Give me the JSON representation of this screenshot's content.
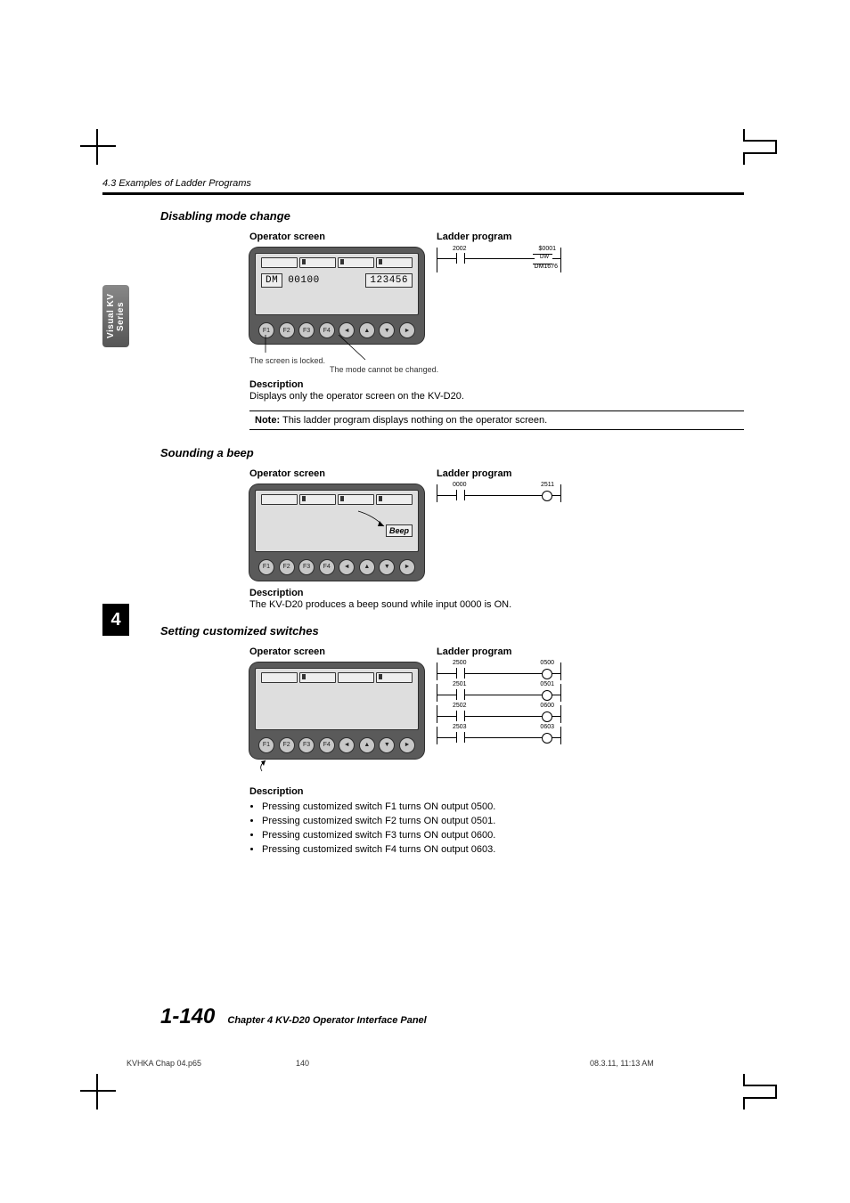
{
  "header": {
    "breadcrumb": "4.3 Examples of Ladder Programs"
  },
  "sideTab": "Visual KV Series",
  "chapterTab": "4",
  "sections": {
    "disable": {
      "title": "Disabling mode change",
      "op_label": "Operator screen",
      "ld_label": "Ladder program",
      "lcd_dm": "DM",
      "lcd_addr": "00100",
      "lcd_val": "123456",
      "callout1": "The screen is locked.",
      "callout2": "The mode cannot be changed.",
      "desc_h": "Description",
      "desc_t": "Displays only the operator screen on the KV-D20.",
      "note_bold": "Note:",
      "note_t": "This ladder program displays nothing on the operator screen.",
      "rung": {
        "in": "2002",
        "out_top": "$0001",
        "out_mid": "DW",
        "out_bot": "DM1676"
      }
    },
    "beep": {
      "title": "Sounding a beep",
      "op_label": "Operator screen",
      "ld_label": "Ladder program",
      "beep_word": "Beep",
      "desc_h": "Description",
      "desc_t": "The KV-D20 produces a beep sound while input 0000 is ON.",
      "rung": {
        "in": "0000",
        "out": "2511"
      }
    },
    "switches": {
      "title": "Setting customized switches",
      "op_label": "Operator screen",
      "ld_label": "Ladder program",
      "desc_h": "Description",
      "bullets": [
        "Pressing customized switch F1 turns ON output 0500.",
        "Pressing customized switch F2 turns ON output 0501.",
        "Pressing customized switch F3 turns ON output 0600.",
        "Pressing customized switch F4 turns ON output 0603."
      ],
      "rungs": [
        {
          "in": "2500",
          "out": "0500"
        },
        {
          "in": "2501",
          "out": "0501"
        },
        {
          "in": "2502",
          "out": "0600"
        },
        {
          "in": "2503",
          "out": "0603"
        }
      ]
    }
  },
  "footer": {
    "page_num": "1-140",
    "chapter": "Chapter 4   KV-D20 Operator Interface Panel",
    "file": "KVHKA Chap 04.p65",
    "seq": "140",
    "stamp": "08.3.11, 11:13 AM"
  },
  "buttons": [
    "F1",
    "F2",
    "F3",
    "F4",
    "◄",
    "▲",
    "▼",
    "►"
  ]
}
